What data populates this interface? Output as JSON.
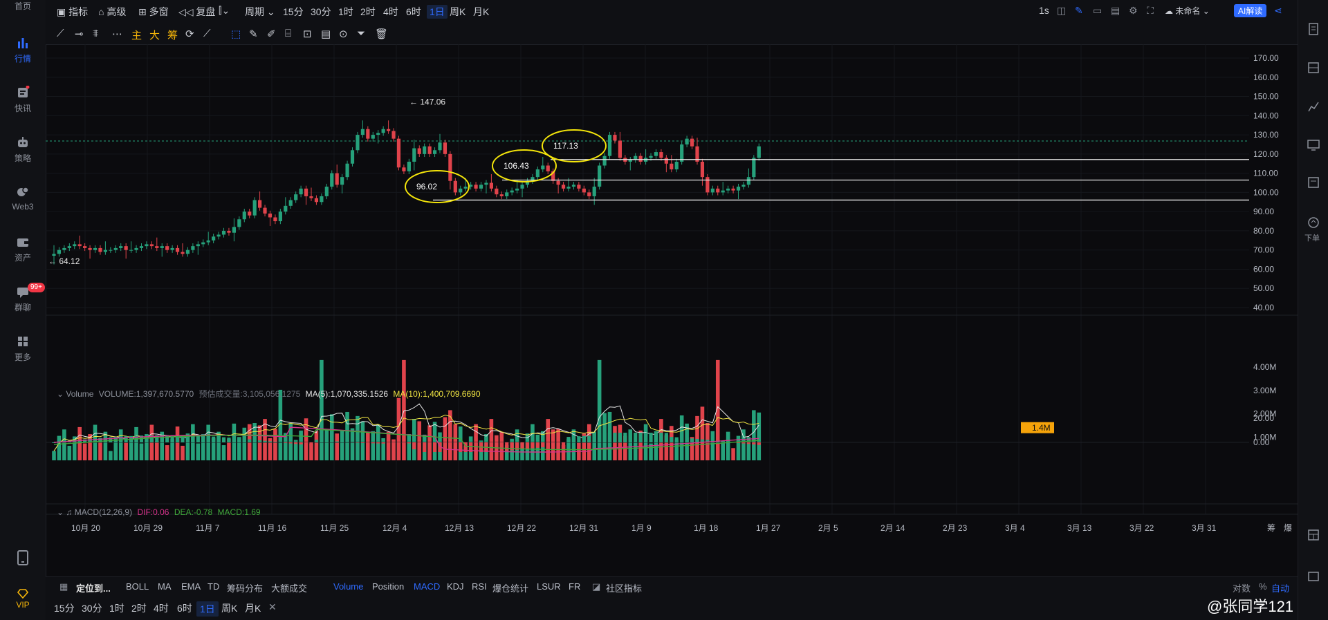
{
  "sidebar": {
    "items": [
      {
        "label": "首页",
        "icon": "home-icon"
      },
      {
        "label": "行情",
        "icon": "bar-chart-icon"
      },
      {
        "label": "快讯",
        "icon": "news-icon"
      },
      {
        "label": "策略",
        "icon": "robot-icon"
      },
      {
        "label": "Web3",
        "icon": "web3-icon"
      },
      {
        "label": "资产",
        "icon": "wallet-icon"
      },
      {
        "label": "群聊",
        "icon": "chat-icon"
      },
      {
        "label": "更多",
        "icon": "grid-icon"
      }
    ],
    "chat_badge": "99+",
    "vip_label": "VIP"
  },
  "topbar": {
    "indicators_label": "指标",
    "advanced_label": "高级",
    "multi_window_label": "多窗",
    "replay_label": "复盘",
    "period_label": "周期",
    "periods": [
      "15分",
      "30分",
      "1时",
      "2时",
      "4时",
      "6时",
      "1日",
      "周K",
      "月K"
    ],
    "active_period": "1日",
    "interval_label": "1s",
    "layout_name": "未命名",
    "ai_label": "AI解读"
  },
  "drawbar": {
    "main_label": "主",
    "big_label": "大",
    "chips_label": "筹"
  },
  "price_axis": [
    "170.00",
    "160.00",
    "150.00",
    "140.00",
    "130.00",
    "120.00",
    "110.00",
    "100.00",
    "90.00",
    "80.00",
    "70.00",
    "60.00",
    "50.00",
    "40.00"
  ],
  "volume_axis": [
    "4.00M",
    "3.00M",
    "2.00M",
    "1.00M"
  ],
  "volume_current_tag": "1.4M",
  "macd_axis": [
    "20.00",
    "0.00"
  ],
  "time_axis": [
    "10月 20",
    "10月 29",
    "11月 7",
    "11月 16",
    "11月 25",
    "12月 4",
    "12月 13",
    "12月 22",
    "12月 31",
    "1月 9",
    "1月 18",
    "1月 27",
    "2月 5",
    "2月 14",
    "2月 23",
    "3月 4",
    "3月 13",
    "3月 22",
    "3月 31"
  ],
  "axis_corner": [
    "筹",
    "爆"
  ],
  "annotations": {
    "high_label": "147.06",
    "low_label": "64.12",
    "levels": [
      "96.02",
      "106.43",
      "117.13"
    ]
  },
  "volume_legend": {
    "name": "Volume",
    "volume": "VOLUME:1,397,670.5770",
    "estimate": "预估成交量:3,105,056.1275",
    "ma5": "MA(5):1,070,335.1526",
    "ma10": "MA(10):1,400,709.6690"
  },
  "macd_legend": {
    "name": "MACD(12,26,9)",
    "dif": "DIF:0.06",
    "dea": "DEA:-0.78",
    "macd": "MACD:1.69"
  },
  "indicator_bar": {
    "locate_label": "定位到...",
    "main_indicators": [
      "BOLL",
      "MA",
      "EMA",
      "TD",
      "筹码分布",
      "大额成交"
    ],
    "sub_indicators": [
      "Volume",
      "Position",
      "MACD",
      "KDJ",
      "RSI",
      "爆仓统计",
      "LSUR",
      "FR"
    ],
    "active_sub": [
      "Volume",
      "MACD"
    ],
    "community_label": "社区指标",
    "log_label": "对数",
    "percent_label": "%",
    "auto_label": "自动"
  },
  "period_bar": {
    "periods": [
      "15分",
      "30分",
      "1时",
      "2时",
      "4时",
      "6时",
      "1日",
      "周K",
      "月K"
    ],
    "active_period": "1日"
  },
  "right_panel": {
    "order_label": "下单"
  },
  "watermark": "@张同学121",
  "colors": {
    "up": "#26a17b",
    "down": "#e0434b",
    "accent": "#2f6bff",
    "level_circle": "#f5e60a",
    "ma5": "#f0e442",
    "ma10": "#e6e6e6",
    "dif": "#d6328a",
    "dea": "#3fa63a"
  }
}
